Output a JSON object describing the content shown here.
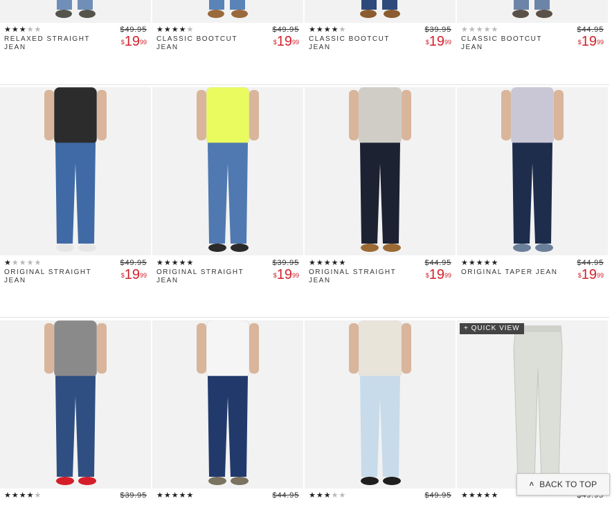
{
  "accent_price_color": "#d2202b",
  "rows": [
    {
      "items": [
        {
          "name": "RELAXED STRAIGHT JEAN",
          "rating": 3,
          "was": "$49.95",
          "cur": "$",
          "dollars": "19",
          "cents": "99",
          "shirt": "#ffffff",
          "jean": "#6f8fb8",
          "shoe": "#55544c"
        },
        {
          "name": "CLASSIC BOOTCUT JEAN",
          "rating": 4,
          "was": "$49.95",
          "cur": "$",
          "dollars": "19",
          "cents": "99",
          "shirt": "#ffffff",
          "jean": "#5a83b8",
          "shoe": "#9a6a3c"
        },
        {
          "name": "CLASSIC BOOTCUT JEAN",
          "rating": 4,
          "was": "$39.95",
          "cur": "$",
          "dollars": "19",
          "cents": "99",
          "shirt": "#ffffff",
          "jean": "#2e4a7a",
          "shoe": "#8a5c30"
        },
        {
          "name": "CLASSIC BOOTCUT JEAN",
          "rating": 0,
          "was": "$44.95",
          "cur": "$",
          "dollars": "19",
          "cents": "99",
          "shirt": "#ffffff",
          "jean": "#6b84a8",
          "shoe": "#5a5148"
        }
      ]
    },
    {
      "items": [
        {
          "name": "ORIGINAL STRAIGHT JEAN",
          "rating": 1,
          "was": "$49.95",
          "cur": "$",
          "dollars": "19",
          "cents": "99",
          "shirt": "#2c2c2c",
          "jean": "#3f6aa5",
          "shoe": "#e6e6e6"
        },
        {
          "name": "ORIGINAL STRAIGHT JEAN",
          "rating": 4.5,
          "was": "$39.95",
          "cur": "$",
          "dollars": "19",
          "cents": "99",
          "shirt": "#e9fb5e",
          "jean": "#4f79b0",
          "shoe": "#2a2a2a"
        },
        {
          "name": "ORIGINAL STRAIGHT JEAN",
          "rating": 4.5,
          "was": "$44.95",
          "cur": "$",
          "dollars": "19",
          "cents": "99",
          "shirt": "#cfcdc6",
          "jean": "#1d2232",
          "shoe": "#9b6a34"
        },
        {
          "name": "ORIGINAL TAPER JEAN",
          "rating": 5,
          "was": "$44.95",
          "cur": "$",
          "dollars": "19",
          "cents": "99",
          "shirt": "#c9c6d6",
          "jean": "#1f2d4c",
          "shoe": "#6a7f9a"
        }
      ]
    },
    {
      "items": [
        {
          "rating": 4,
          "was": "$39.95",
          "shirt": "#8a8a8a",
          "jean": "#2f4f82",
          "shoe": "#d41f2a"
        },
        {
          "rating": 5,
          "was": "$44.95",
          "shirt": "#f5f5f5",
          "jean": "#223a6b",
          "shoe": "#7a7360"
        },
        {
          "rating": 3,
          "was": "$49.95",
          "shirt": "#e8e4da",
          "jean": "#c7dbea",
          "shoe": "#1e1e1e"
        },
        {
          "rating": 5,
          "was": "$49.95",
          "shirt": "#ffffff",
          "jean": "#dcded8",
          "shoe": "#dcded8",
          "quick_view": "+ QUICK VIEW"
        }
      ]
    }
  ],
  "back_to_top": "BACK TO TOP"
}
